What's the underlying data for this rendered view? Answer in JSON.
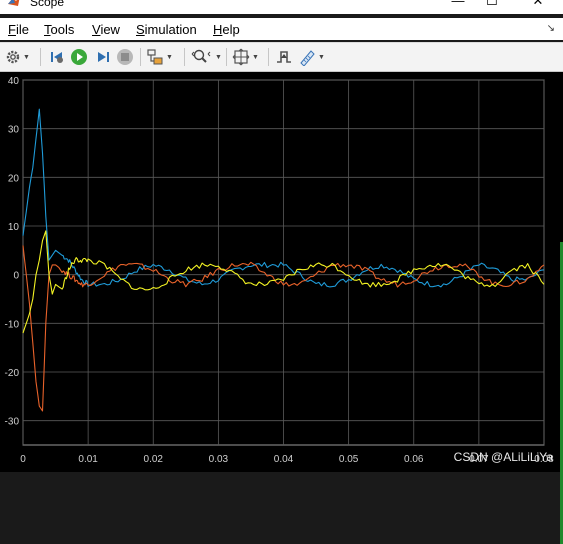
{
  "window": {
    "title": "Scope",
    "minimize": "—",
    "maximize": "☐",
    "close": "✕"
  },
  "menu": {
    "items": [
      {
        "key": "F",
        "rest": "ile"
      },
      {
        "key": "T",
        "rest": "ools"
      },
      {
        "key": "V",
        "rest": "iew"
      },
      {
        "key": "S",
        "rest": "imulation"
      },
      {
        "key": "H",
        "rest": "elp"
      }
    ],
    "pin": "↘"
  },
  "toolbar": {
    "buttons": [
      "settings",
      "step-back",
      "run",
      "step-forward",
      "stop",
      "highlight-block",
      "zoom",
      "fit-to-view",
      "triggers",
      "measurements"
    ]
  },
  "watermark": "CSDN @ALiLiLiYa",
  "chart_data": {
    "type": "line",
    "xlim": [
      0,
      0.08
    ],
    "ylim": [
      -35,
      40
    ],
    "xticks": [
      "0",
      "0.01",
      "0.02",
      "0.03",
      "0.04",
      "0.05",
      "0.06",
      "0.07",
      "0.08"
    ],
    "yticks": [
      "40",
      "30",
      "20",
      "10",
      "0",
      "-10",
      "-20",
      "-30"
    ],
    "grid": true,
    "background": "#000000",
    "series": [
      {
        "color": "#1f9bd8",
        "x": [
          0,
          0.0005,
          0.001,
          0.0015,
          0.002,
          0.0025,
          0.003,
          0.0035,
          0.004,
          0.0045,
          0.005,
          0.006,
          0.007,
          0.008,
          0.009,
          0.01,
          0.0125,
          0.015,
          0.0175,
          0.02,
          0.0225,
          0.025,
          0.0275,
          0.03,
          0.0325,
          0.035,
          0.0375,
          0.04,
          0.0425,
          0.045,
          0.0475,
          0.05,
          0.0525,
          0.055,
          0.0575,
          0.06,
          0.0625,
          0.065,
          0.0675,
          0.07,
          0.0725,
          0.075,
          0.0775,
          0.08
        ],
        "y": [
          8,
          13,
          18,
          22,
          28,
          34,
          25,
          12,
          3,
          4,
          5,
          4,
          3,
          1,
          -1,
          -2,
          -2,
          -1,
          1,
          2,
          1,
          -1,
          -2,
          -1,
          1,
          2,
          2,
          2,
          0,
          -2,
          -2,
          -1,
          1,
          2,
          1,
          -1,
          -2,
          -2,
          0,
          2,
          1,
          -1,
          -1,
          1
        ]
      },
      {
        "color": "#e8622a",
        "x": [
          0,
          0.0005,
          0.001,
          0.0015,
          0.002,
          0.0025,
          0.003,
          0.0035,
          0.004,
          0.0045,
          0.005,
          0.006,
          0.007,
          0.008,
          0.009,
          0.01,
          0.0125,
          0.015,
          0.0175,
          0.02,
          0.0225,
          0.025,
          0.0275,
          0.03,
          0.0325,
          0.035,
          0.0375,
          0.04,
          0.0425,
          0.045,
          0.0475,
          0.05,
          0.0525,
          0.055,
          0.0575,
          0.06,
          0.0625,
          0.065,
          0.0675,
          0.07,
          0.0725,
          0.075,
          0.0775,
          0.08
        ],
        "y": [
          6,
          0,
          -6,
          -14,
          -22,
          -27,
          -28,
          -10,
          0,
          2,
          2,
          1,
          0,
          -1,
          -2,
          -2,
          0,
          2,
          2,
          1,
          -1,
          -2,
          -1,
          1,
          2,
          2,
          0,
          -2,
          -2,
          0,
          2,
          2,
          1,
          -1,
          -2,
          -1,
          1,
          2,
          2,
          0,
          -2,
          -2,
          -1,
          2
        ]
      },
      {
        "color": "#f2f223",
        "x": [
          0,
          0.0005,
          0.001,
          0.0015,
          0.002,
          0.0025,
          0.003,
          0.0035,
          0.004,
          0.0045,
          0.005,
          0.006,
          0.007,
          0.008,
          0.009,
          0.01,
          0.0125,
          0.015,
          0.0175,
          0.02,
          0.0225,
          0.025,
          0.0275,
          0.03,
          0.0325,
          0.035,
          0.0375,
          0.04,
          0.0425,
          0.045,
          0.0475,
          0.05,
          0.0525,
          0.055,
          0.0575,
          0.06,
          0.0625,
          0.065,
          0.0675,
          0.07,
          0.0725,
          0.075,
          0.0775,
          0.08
        ],
        "y": [
          -12,
          -10,
          -8,
          -5,
          0,
          3,
          7,
          9,
          0,
          -4,
          -2,
          -3,
          1,
          3,
          3,
          3,
          2,
          -1,
          -3,
          -3,
          -1,
          1,
          2,
          2,
          0,
          -2,
          -2,
          -1,
          1,
          2,
          2,
          0,
          -2,
          -2,
          -1,
          1,
          2,
          2,
          0,
          -2,
          -2,
          1,
          2,
          -2
        ]
      }
    ]
  }
}
